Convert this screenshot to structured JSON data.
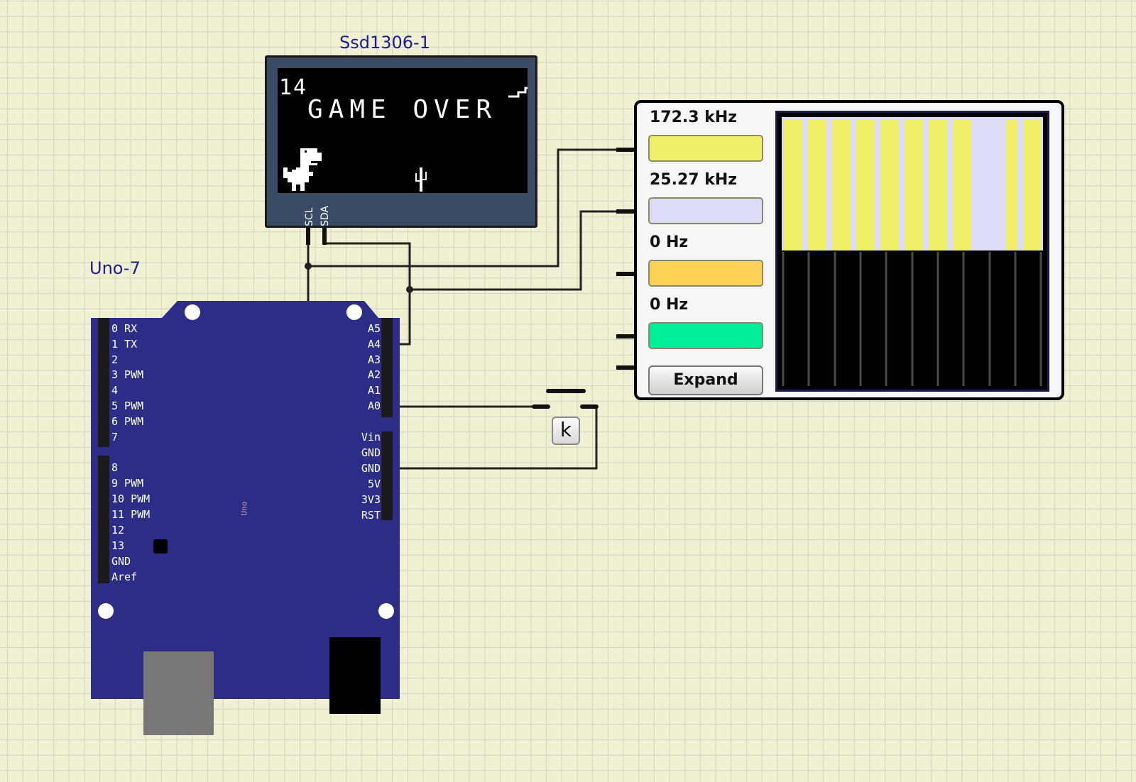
{
  "titles": {
    "oled": "Ssd1306-1",
    "uno": "Uno-7"
  },
  "oled": {
    "score": "14",
    "message": "GAME OVER",
    "pins": [
      "SCL",
      "SDA"
    ]
  },
  "uno": {
    "board_text": "Uno",
    "left_pins": [
      "0 RX",
      "1 TX",
      "2",
      "3 PWM",
      "4",
      "5 PWM",
      "6 PWM",
      "7",
      "8",
      "9 PWM",
      "10 PWM",
      "11 PWM",
      "12",
      "13",
      "GND",
      "Aref"
    ],
    "right_pins": [
      "A5",
      "A4",
      "A3",
      "A2",
      "A1",
      "A0",
      "Vin",
      "GND",
      "GND",
      "5V",
      "3V3",
      "RST"
    ]
  },
  "analyzer": {
    "channels": [
      {
        "freq": "172.3 kHz",
        "color": "#f0ef68"
      },
      {
        "freq": "25.27 kHz",
        "color": "#dcdcf8"
      },
      {
        "freq": "0 Hz",
        "color": "#fdd155"
      },
      {
        "freq": "0 Hz",
        "color": "#00ee98"
      }
    ],
    "expand_label": "Expand"
  },
  "button": {
    "key": "k"
  }
}
